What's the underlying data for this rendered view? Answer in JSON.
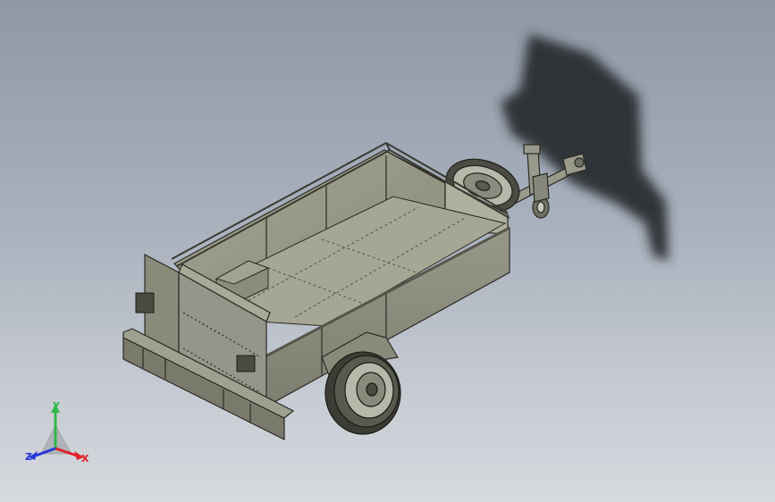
{
  "viewport": {
    "background_top": "#8e98a6",
    "background_bottom": "#d6d9de"
  },
  "model": {
    "body_color": "#8f8f7f",
    "floor_color": "#9a9a88",
    "shadow_color": "#2b2e33"
  },
  "triad": {
    "x_label": "X",
    "y_label": "Y",
    "z_label": "Z",
    "x_color": "#e0202a",
    "y_color": "#2fb84a",
    "z_color": "#2638d8"
  }
}
